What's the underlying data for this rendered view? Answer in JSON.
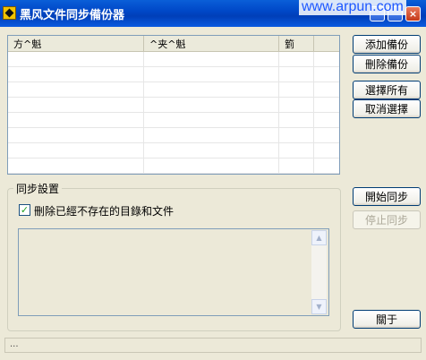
{
  "window": {
    "title": "黑风文件同步備份器",
    "close_glyph": "×"
  },
  "watermark": "www.arpun.com",
  "list": {
    "columns": [
      "方^魁",
      "^夹^魁",
      "箌",
      ""
    ]
  },
  "sync_group": {
    "title": "同步設置",
    "checkbox_label": "刪除已經不存在的目錄和文件",
    "checkbox_checked": true
  },
  "buttons": {
    "add": "添加備份",
    "remove": "刪除備份",
    "select_all": "選擇所有",
    "deselect": "取消選擇",
    "start": "開始同步",
    "stop": "停止同步",
    "about": "關于"
  },
  "status": "..."
}
